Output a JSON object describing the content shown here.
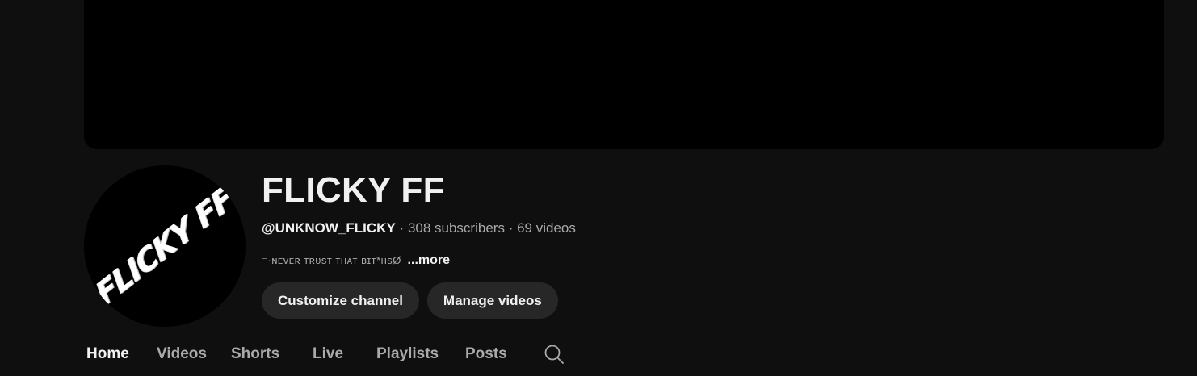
{
  "channel": {
    "name": "FLICKY FF",
    "handle": "@UNKNOW_FLICKY",
    "subscribers": "308 subscribers",
    "videos": "69 videos",
    "separator": "·",
    "description": "⁻·ɴᴇᴠᴇʀ ᴛʀᴜsᴛ ᴛʜᴀᴛ ʙɪᴛ*ʜsØ",
    "more_label": "...more",
    "avatar_text": "FLICKY FF"
  },
  "actions": {
    "customize_label": "Customize channel",
    "manage_label": "Manage videos"
  },
  "tabs": [
    {
      "label": "Home",
      "active": true
    },
    {
      "label": "Videos"
    },
    {
      "label": "Shorts"
    },
    {
      "label": "Live"
    },
    {
      "label": "Playlists"
    },
    {
      "label": "Posts"
    }
  ],
  "icons": {
    "search": "search-icon"
  },
  "colors": {
    "background": "#0f0f0f",
    "banner": "#000000",
    "button": "#272727",
    "text_primary": "#f1f1f1",
    "text_secondary": "#aaaaaa"
  }
}
